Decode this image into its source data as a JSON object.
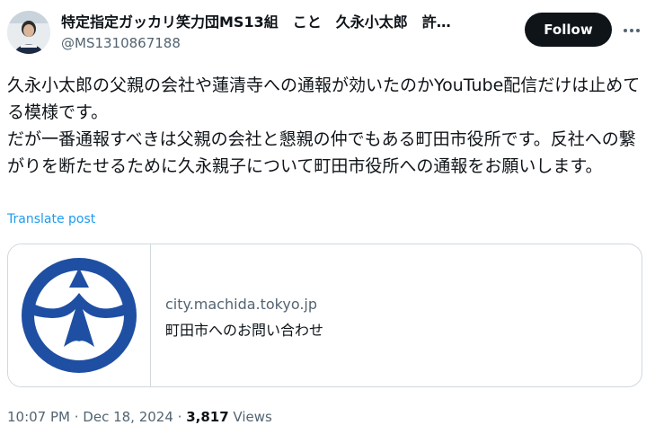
{
  "author": {
    "display_name": "特定指定ガッカリ笑力団MS13組　こと　久永小太郎　許…",
    "handle": "@MS1310867188"
  },
  "follow_label": "Follow",
  "more_icon": "more-options-icon",
  "tweet": {
    "paragraph1": "久永小太郎の父親の会社や蓮清寺への通報が効いたのかYouTube配信だけは止めてる模様です。",
    "paragraph2": "だが一番通報すべきは父親の会社と懇親の仲でもある町田市役所です。反社への繋がりを断たせるために久永親子について町田市役所への通報をお願いします。"
  },
  "translate_label": "Translate post",
  "link_card": {
    "domain": "city.machida.tokyo.jp",
    "title": "町田市へのお問い合わせ",
    "logo": "machida-city-emblem"
  },
  "meta": {
    "time": "10:07 PM",
    "separator1": " · ",
    "date": "Dec 18, 2024",
    "separator2": " · ",
    "views_count": "3,817",
    "views_label": " Views"
  },
  "colors": {
    "accent": "#1d9bf0",
    "text": "#0f1419",
    "secondary": "#536471",
    "emblem": "#1f4fa3"
  }
}
